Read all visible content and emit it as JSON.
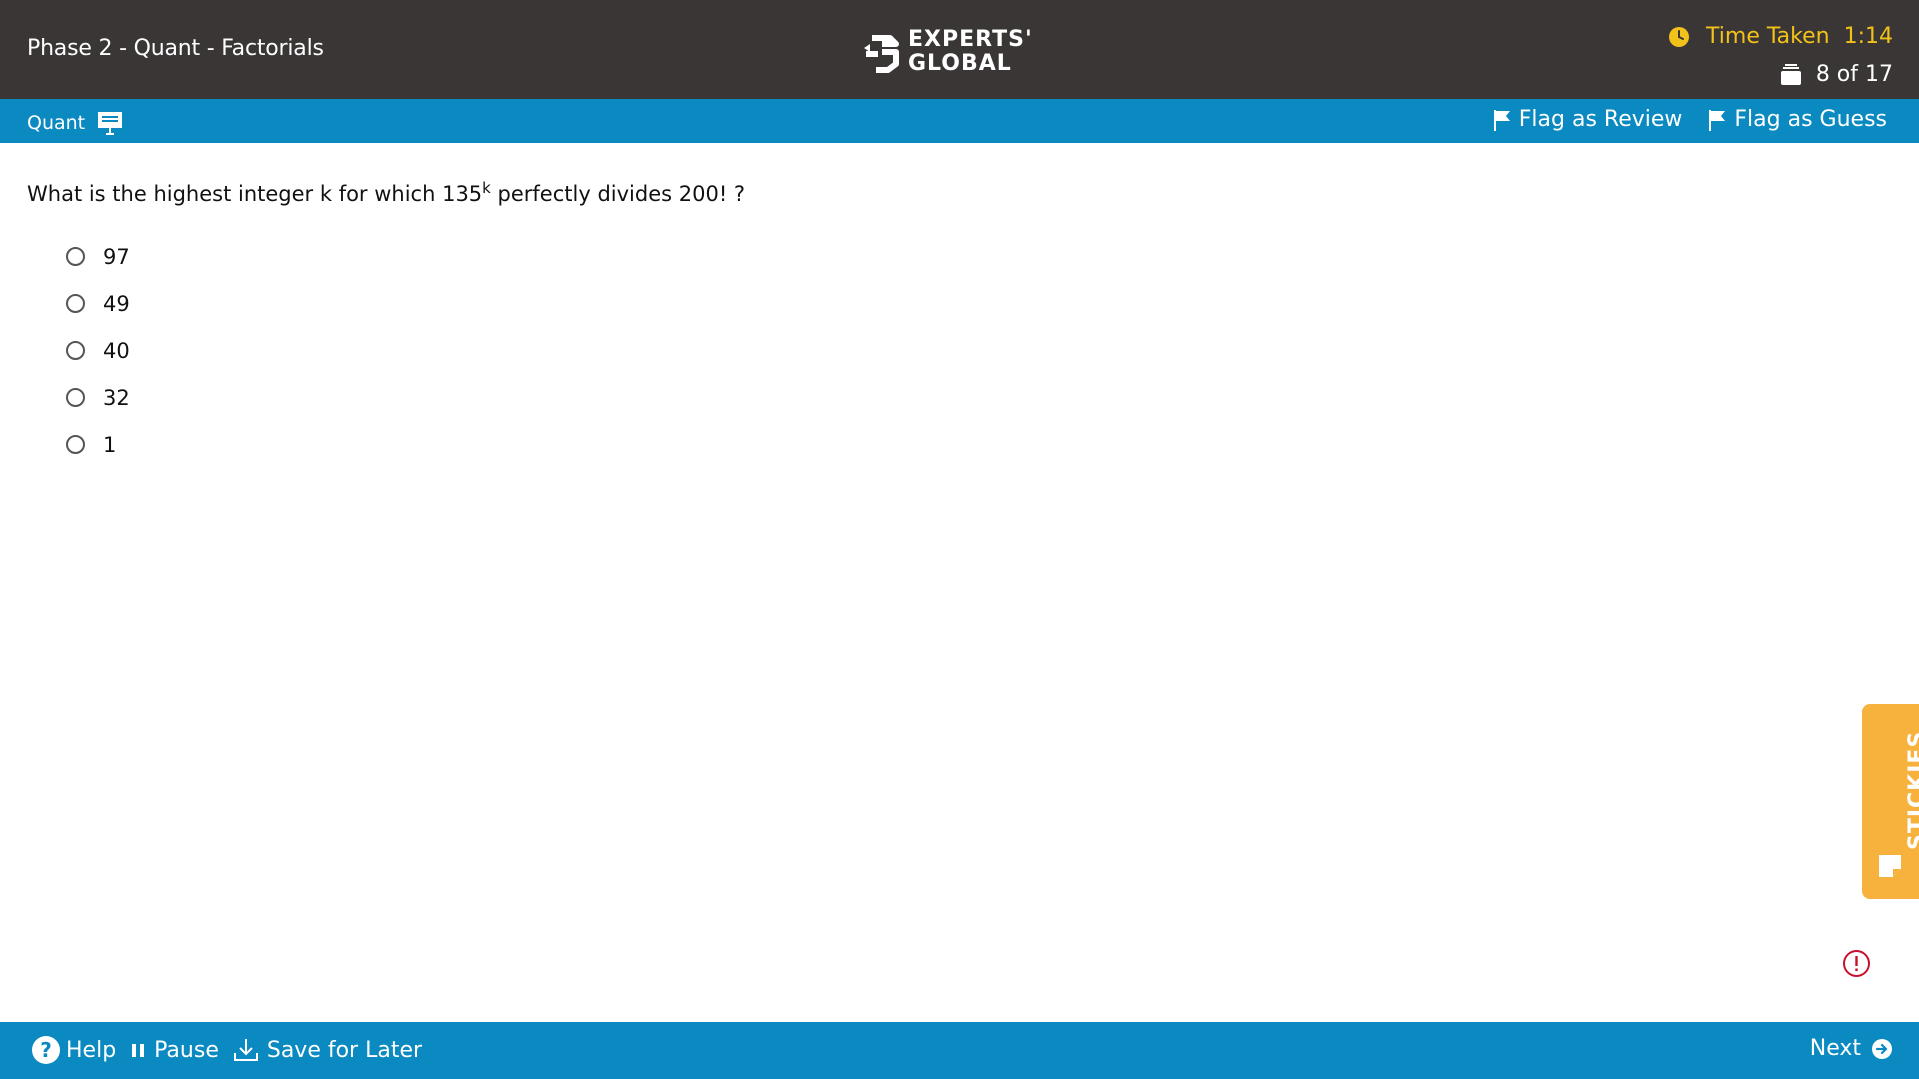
{
  "header": {
    "test_title": "Phase 2 - Quant - Factorials",
    "logo_line1": "EXPERTS'",
    "logo_line2": "GLOBAL",
    "time_label": "Time Taken",
    "time_value": "1:14",
    "question_counter": "8 of 17"
  },
  "subbar": {
    "section_label": "Quant",
    "flag_review_label": "Flag as Review",
    "flag_guess_label": "Flag as Guess"
  },
  "question": {
    "text_before": "What is the highest integer k for which 135",
    "superscript": "k",
    "text_after": " perfectly divides 200! ?",
    "options": [
      "97",
      "49",
      "40",
      "32",
      "1"
    ]
  },
  "stickies": {
    "label": "STICKIES"
  },
  "footer": {
    "help_label": "Help",
    "pause_label": "Pause",
    "save_label": "Save for Later",
    "next_label": "Next"
  },
  "colors": {
    "topbar": "#3a3636",
    "accent_blue": "#0b89c1",
    "timer_yellow": "#f2c21b",
    "stickies_orange": "#f6b23c",
    "alert_red": "#c8102e"
  },
  "icons": [
    "clock-icon",
    "stack-icon",
    "whiteboard-icon",
    "flag-icon",
    "note-icon",
    "alert-icon",
    "help-icon",
    "pause-icon",
    "download-icon",
    "arrow-right-circle-icon"
  ]
}
